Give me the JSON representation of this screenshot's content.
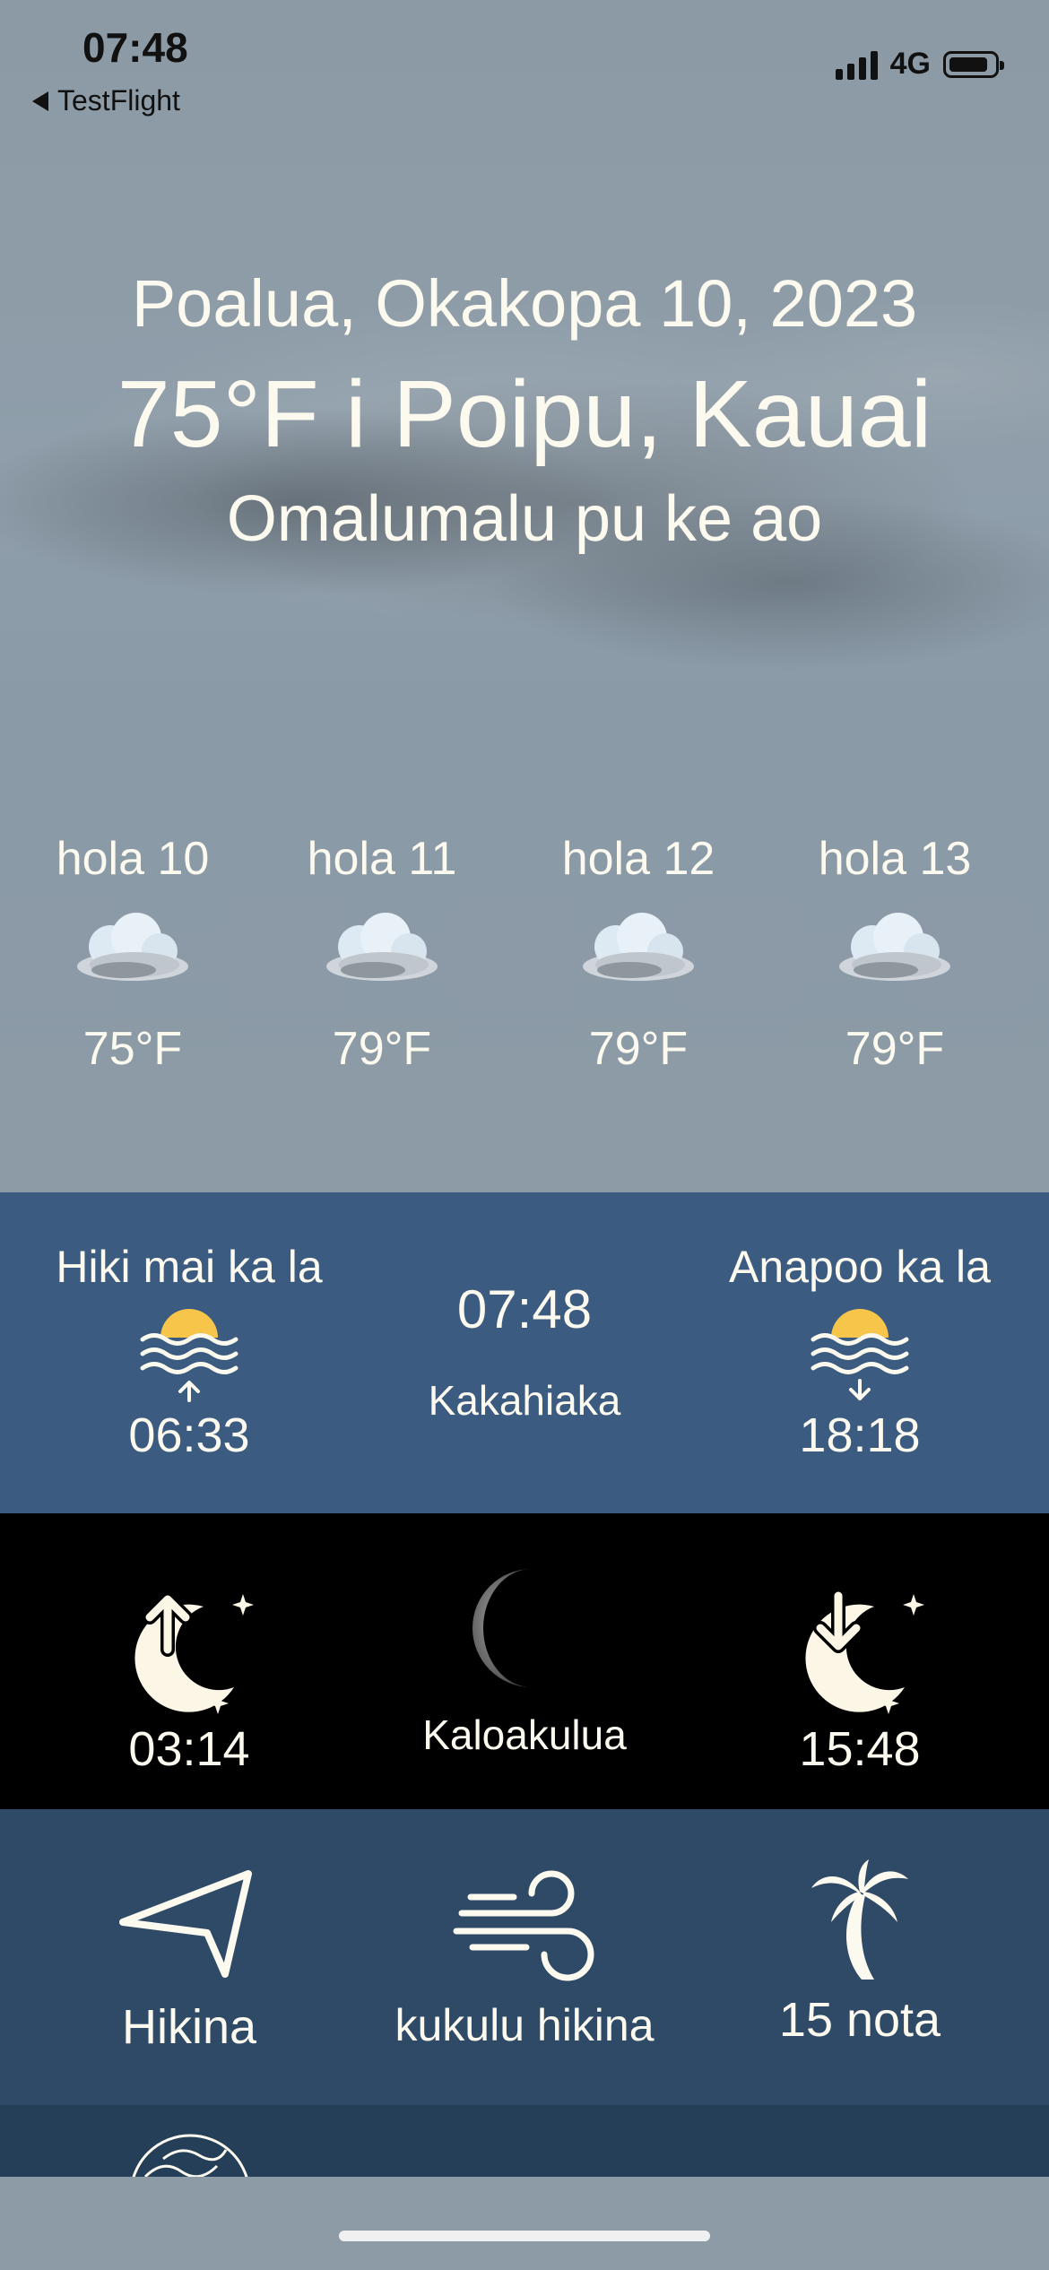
{
  "status_bar": {
    "time": "07:48",
    "back_label": "TestFlight",
    "network": "4G"
  },
  "header": {
    "date": "Poalua, Okakopa 10,  2023",
    "temperature_location": "75°F i Poipu, Kauai",
    "condition": "Omalumalu pu ke ao"
  },
  "hourly": [
    {
      "label": "hola 10",
      "temp": "75°F",
      "icon": "cloudy-icon"
    },
    {
      "label": "hola 11",
      "temp": "79°F",
      "icon": "cloudy-icon"
    },
    {
      "label": "hola 12",
      "temp": "79°F",
      "icon": "cloudy-icon"
    },
    {
      "label": "hola 13",
      "temp": "79°F",
      "icon": "cloudy-icon"
    }
  ],
  "sun": {
    "sunrise_label": "Hiki mai ka la",
    "sunrise_time": "06:33",
    "current_time": "07:48",
    "period": "Kakahiaka",
    "sunset_label": "Anapoo ka la",
    "sunset_time": "18:18",
    "sun_color": "#f6c54a"
  },
  "moon": {
    "moonrise_time": "03:14",
    "phase_name": "Kaloakulua",
    "moonset_time": "15:48"
  },
  "wind": {
    "direction": "Hikina",
    "description": "kukulu hikina",
    "speed": "15 nota"
  },
  "colors": {
    "sun_panel": "#3c5b80",
    "moon_panel": "#000000",
    "wind_panel": "#2f4a67",
    "text": "#fcf9ef"
  }
}
